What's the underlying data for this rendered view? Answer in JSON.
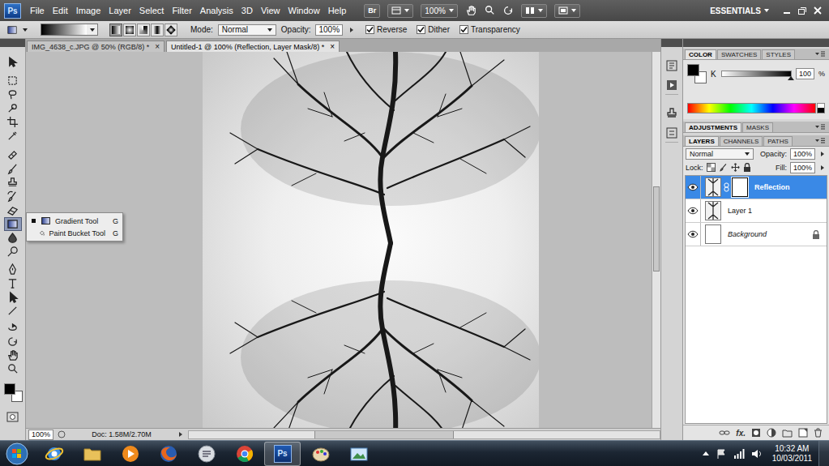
{
  "app": {
    "logo": "Ps",
    "menus": [
      "File",
      "Edit",
      "Image",
      "Layer",
      "Select",
      "Filter",
      "Analysis",
      "3D",
      "View",
      "Window",
      "Help"
    ],
    "bridge": "Br",
    "zoom": "100%",
    "workspace": "ESSENTIALS"
  },
  "options_bar": {
    "gradient_types": [
      {
        "kind": "linear",
        "selected": true
      },
      {
        "kind": "radial",
        "selected": false
      },
      {
        "kind": "angle",
        "selected": false
      },
      {
        "kind": "reflected",
        "selected": false
      },
      {
        "kind": "diamond",
        "selected": false
      }
    ],
    "mode_label": "Mode:",
    "mode": "Normal",
    "opacity_label": "Opacity:",
    "opacity": "100%",
    "checkboxes": [
      {
        "label": "Reverse",
        "checked": true
      },
      {
        "label": "Dither",
        "checked": true
      },
      {
        "label": "Transparency",
        "checked": true
      }
    ]
  },
  "tools": [
    {
      "kind": "move",
      "selected": false
    },
    {
      "kind": "marquee",
      "selected": false
    },
    {
      "kind": "lasso",
      "selected": false
    },
    {
      "kind": "quick-select",
      "selected": false
    },
    {
      "kind": "crop",
      "selected": false
    },
    {
      "kind": "eyedropper",
      "selected": false
    },
    {
      "kind": "heal",
      "selected": false
    },
    {
      "kind": "brush",
      "selected": false
    },
    {
      "kind": "stamp",
      "selected": false
    },
    {
      "kind": "history",
      "selected": false
    },
    {
      "kind": "eraser",
      "selected": false
    },
    {
      "kind": "gradient",
      "selected": true
    },
    {
      "kind": "blur",
      "selected": false
    },
    {
      "kind": "dodge",
      "selected": false
    },
    {
      "kind": "pen",
      "selected": false
    },
    {
      "kind": "type",
      "selected": false
    },
    {
      "kind": "path-select",
      "selected": false
    },
    {
      "kind": "line",
      "selected": false
    },
    {
      "kind": "rotate3d",
      "selected": false
    },
    {
      "kind": "orbit3d",
      "selected": false
    },
    {
      "kind": "hand",
      "selected": false
    },
    {
      "kind": "zoom",
      "selected": false
    }
  ],
  "tool_flyout": [
    {
      "label": "Gradient Tool",
      "shortcut": "G",
      "kind": "gradient",
      "selected": true
    },
    {
      "label": "Paint Bucket Tool",
      "shortcut": "G",
      "kind": "bucket",
      "selected": false
    }
  ],
  "document_tabs": [
    {
      "label": "IMG_4638_c.JPG @ 50% (RGB/8) *",
      "close": "×",
      "selected": false
    },
    {
      "label": "Untitled-1 @ 100% (Reflection, Layer Mask/8) *",
      "close": "×",
      "selected": true
    }
  ],
  "status_bar": {
    "zoom": "100%",
    "doc": "Doc: 1.58M/2.70M"
  },
  "color_panel": {
    "tabs": [
      {
        "label": "COLOR",
        "selected": true
      },
      {
        "label": "SWATCHES",
        "selected": false
      },
      {
        "label": "STYLES",
        "selected": false
      }
    ],
    "channel": "K",
    "value": "100",
    "unit": "%",
    "level": 1
  },
  "adjust_panel": {
    "tabs": [
      {
        "label": "ADJUSTMENTS",
        "selected": true
      },
      {
        "label": "MASKS",
        "selected": false
      }
    ]
  },
  "layers_panel": {
    "tabs": [
      {
        "label": "LAYERS",
        "selected": true
      },
      {
        "label": "CHANNELS",
        "selected": false
      },
      {
        "label": "PATHS",
        "selected": false
      }
    ],
    "blend_mode": "Normal",
    "opacity_label": "Opacity:",
    "opacity": "100%",
    "lock_label": "Lock:",
    "fill_label": "Fill:",
    "fill": "100%",
    "layers": [
      {
        "name": "Reflection",
        "selected": true,
        "visible": true,
        "has_mask": true,
        "locked": false,
        "italic": false
      },
      {
        "name": "Layer 1",
        "selected": false,
        "visible": true,
        "has_mask": false,
        "locked": false,
        "italic": false
      },
      {
        "name": "Background",
        "selected": false,
        "visible": true,
        "has_mask": false,
        "locked": true,
        "italic": true
      }
    ],
    "fx_label": "fx."
  },
  "taskbar": {
    "apps": [
      {
        "kind": "ie",
        "selected": false
      },
      {
        "kind": "explorer",
        "selected": false
      },
      {
        "kind": "media",
        "selected": false
      },
      {
        "kind": "firefox",
        "selected": false
      },
      {
        "kind": "messenger",
        "selected": false
      },
      {
        "kind": "chrome",
        "selected": false
      },
      {
        "kind": "photoshop",
        "selected": true,
        "label": "Ps"
      },
      {
        "kind": "paint",
        "selected": false
      },
      {
        "kind": "photos",
        "selected": false
      }
    ],
    "time": "10:32 AM",
    "date": "10/03/2011"
  }
}
